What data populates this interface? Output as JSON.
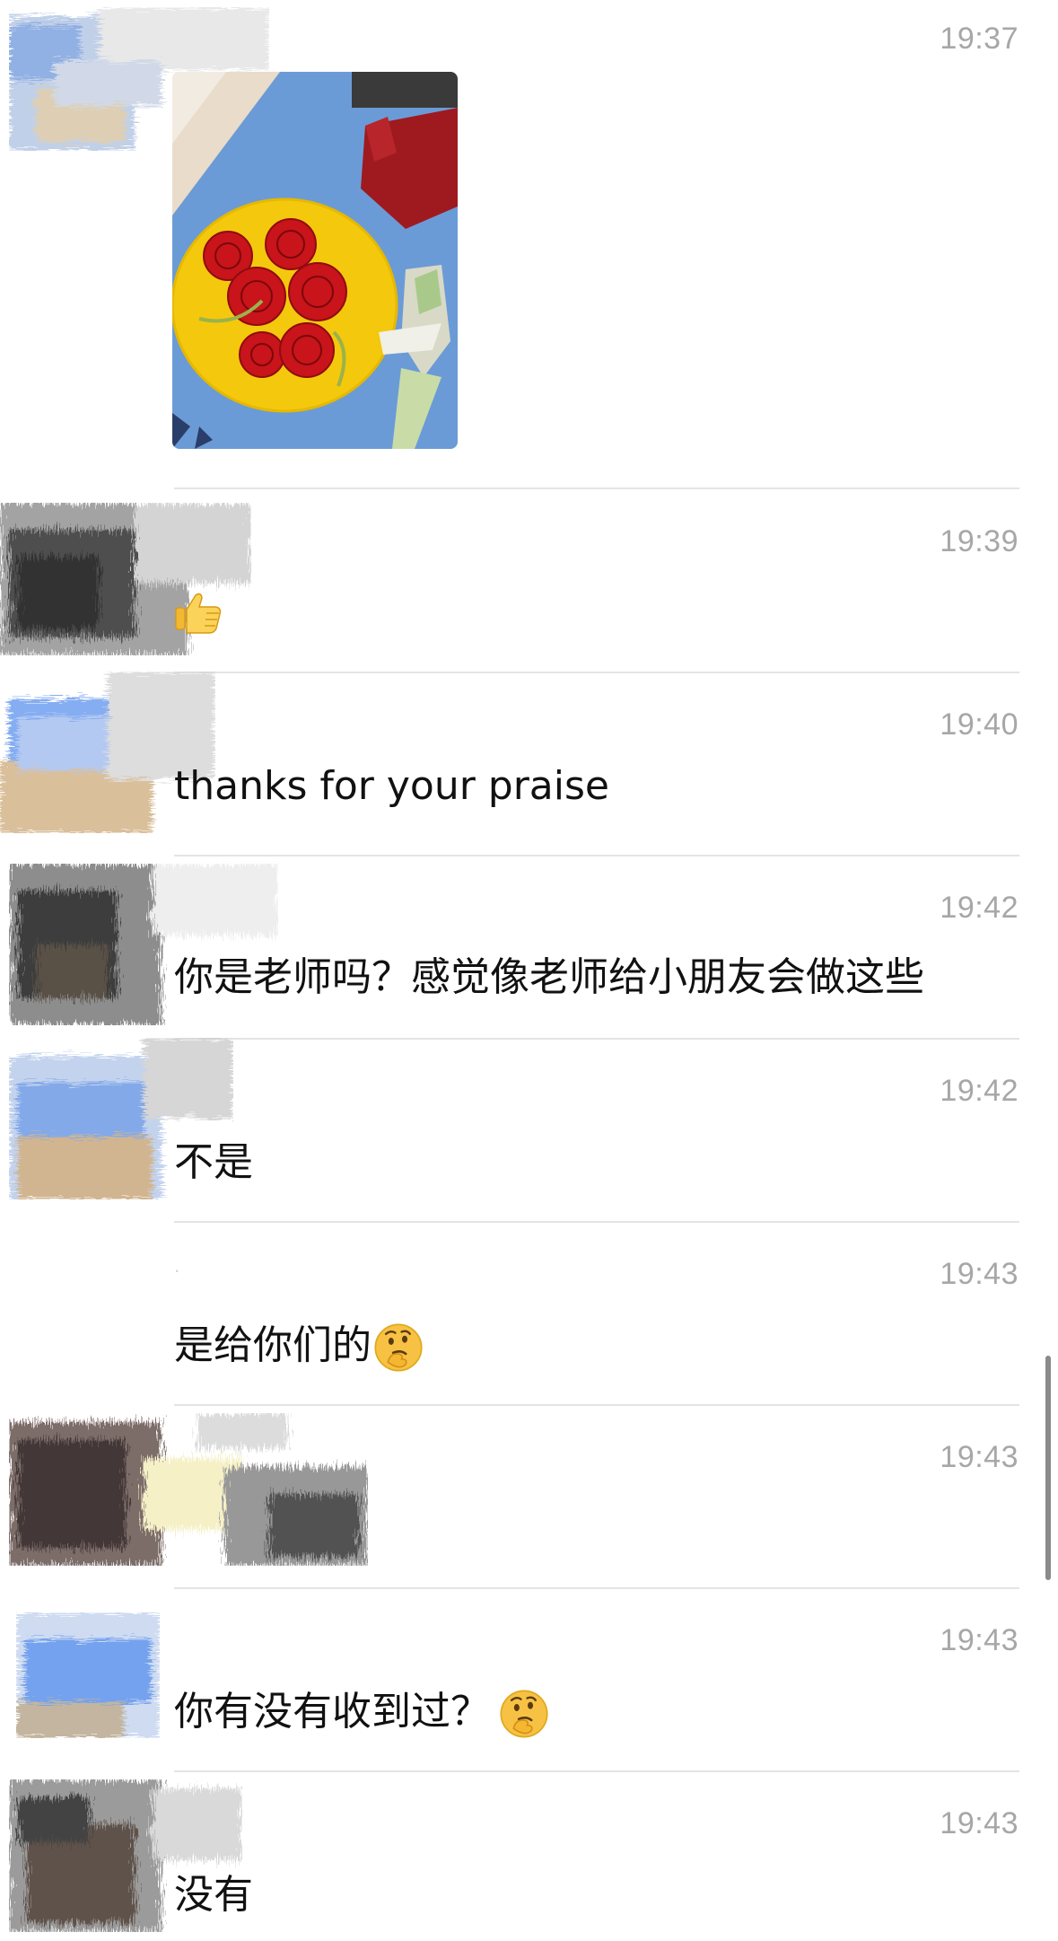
{
  "messages": [
    {
      "time": "19:37",
      "type": "image",
      "image_alt": "paper roses on yellow plate"
    },
    {
      "time": "19:39",
      "type": "emoji",
      "emoji": "thumbs-up-icon"
    },
    {
      "time": "19:40",
      "type": "text",
      "text": "thanks for your praise"
    },
    {
      "time": "19:42",
      "type": "text",
      "text": "你是老师吗？感觉像老师给小朋友会做这些"
    },
    {
      "time": "19:42",
      "type": "text",
      "text": "不是"
    },
    {
      "time": "19:43",
      "type": "text",
      "text": "是给你们的",
      "emoji": "thinking-face-icon"
    },
    {
      "time": "19:43",
      "type": "text",
      "text": ""
    },
    {
      "time": "19:43",
      "type": "text",
      "text": "你有没有收到过？",
      "emoji": "thinking-face-icon"
    },
    {
      "time": "19:43",
      "type": "text",
      "text": "没有"
    }
  ],
  "colors": {
    "timestamp": "#a7a7a7",
    "divider": "#e4e4e4",
    "text": "#111111"
  }
}
